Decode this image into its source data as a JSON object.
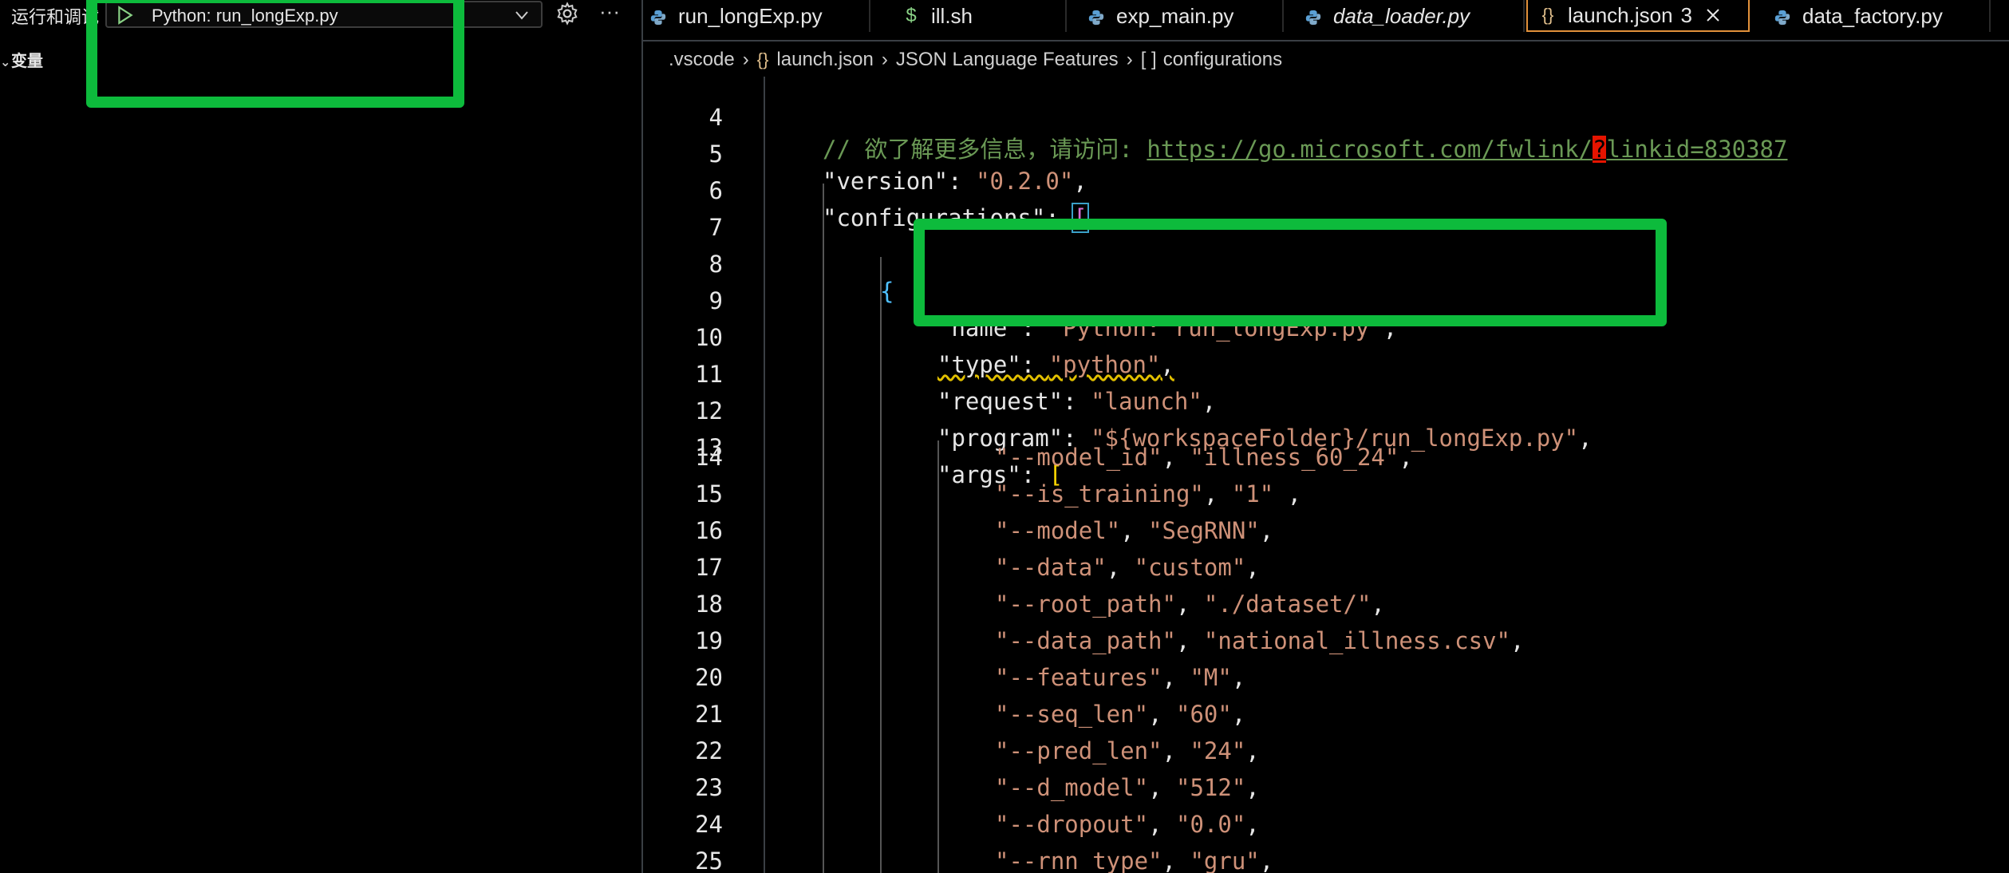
{
  "debug_panel": {
    "title": "运行和调试",
    "selected_config": "Python: run_longExp.py",
    "variables_label": "变量"
  },
  "tabs": [
    {
      "label": "run_longExp.py",
      "icon": "python-icon",
      "italic": false,
      "active": false
    },
    {
      "label": "ill.sh",
      "icon": "shell-icon",
      "italic": false,
      "active": false
    },
    {
      "label": "exp_main.py",
      "icon": "python-icon",
      "italic": false,
      "active": false
    },
    {
      "label": "data_loader.py",
      "icon": "python-icon",
      "italic": true,
      "active": false
    },
    {
      "label": "launch.json",
      "icon": "json-icon",
      "italic": false,
      "active": true,
      "badge": "3"
    },
    {
      "label": "data_factory.py",
      "icon": "python-icon",
      "italic": false,
      "active": false
    }
  ],
  "breadcrumb": {
    "folder": ".vscode",
    "file": "launch.json",
    "section": "JSON Language Features",
    "symbol": "configurations"
  },
  "editor": {
    "line_numbers": [
      "4",
      "5",
      "6",
      "7",
      "8",
      "9",
      "10",
      "11",
      "12",
      "13",
      "14",
      "15",
      "16",
      "17",
      "18",
      "19",
      "20",
      "21",
      "22",
      "23",
      "24",
      "25"
    ],
    "comment_prefix": "// 欲了解更多信息，请访问: ",
    "comment_link_a": "https://go.microsoft.com/fwlink/",
    "comment_link_q": "?",
    "comment_link_b": "linkid=830387",
    "version_key": "\"version\"",
    "version_val": "\"0.2.0\"",
    "configurations_key": "\"configurations\"",
    "name_key": "\"name\"",
    "name_val": "\"Python: run_longExp.py\"",
    "type_key": "\"type\"",
    "type_val": "\"python\"",
    "request_key": "\"request\"",
    "request_val": "\"launch\"",
    "program_key": "\"program\"",
    "program_val": "\"${workspaceFolder}/run_longExp.py\"",
    "args_key": "\"args\"",
    "args": [
      {
        "k": "\"--model_id\"",
        "v": "\"illness_60_24\"",
        "tail": ","
      },
      {
        "k": "\"--is_training\"",
        "v": "\"1\"",
        "tail": " ,"
      },
      {
        "k": "\"--model\"",
        "v": "\"SegRNN\"",
        "tail": ","
      },
      {
        "k": "\"--data\"",
        "v": "\"custom\"",
        "tail": ","
      },
      {
        "k": "\"--root_path\"",
        "v": "\"./dataset/\"",
        "tail": ","
      },
      {
        "k": "\"--data_path\"",
        "v": "\"national_illness.csv\"",
        "tail": ","
      },
      {
        "k": "\"--features\"",
        "v": "\"M\"",
        "tail": ","
      },
      {
        "k": "\"--seq_len\"",
        "v": "\"60\"",
        "tail": ","
      },
      {
        "k": "\"--pred_len\"",
        "v": "\"24\"",
        "tail": ","
      },
      {
        "k": "\"--d_model\"",
        "v": "\"512\"",
        "tail": ","
      },
      {
        "k": "\"--dropout\"",
        "v": "\"0.0\"",
        "tail": ","
      },
      {
        "k": "\"--rnn_type\"",
        "v": "\"gru\"",
        "tail": ","
      }
    ]
  },
  "colors": {
    "annotation_green": "#0dbb3c",
    "active_tab_border": "#e2913a",
    "string": "#ce9178",
    "comment": "#6a9955"
  }
}
